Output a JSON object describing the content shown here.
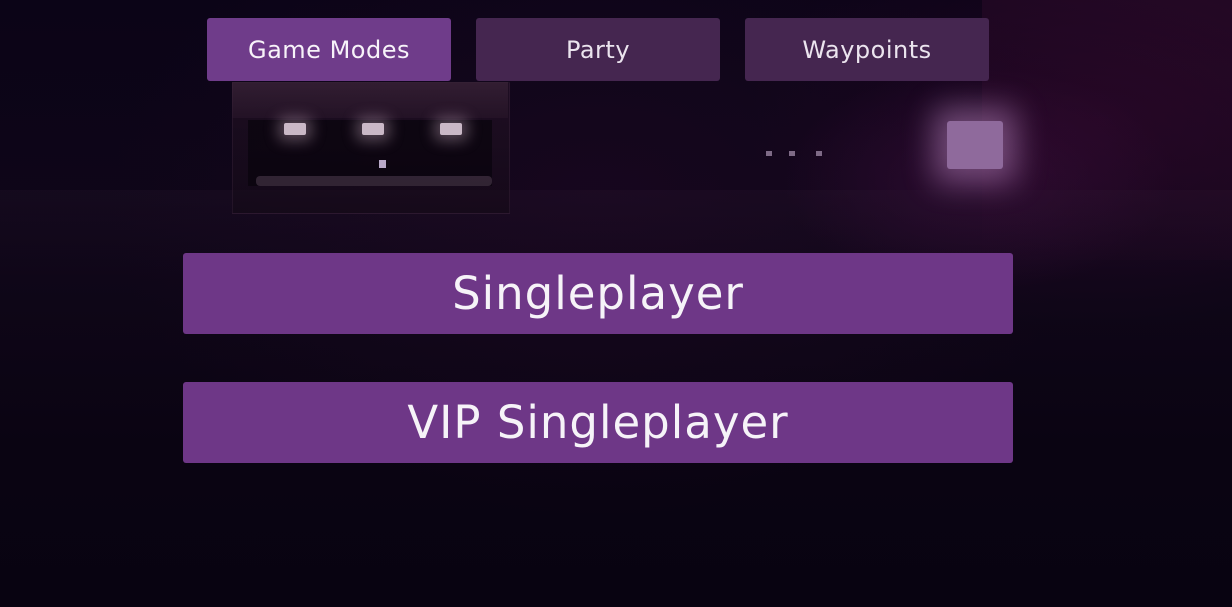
{
  "tabs": [
    {
      "label": "Game Modes",
      "active": true
    },
    {
      "label": "Party",
      "active": false
    },
    {
      "label": "Waypoints",
      "active": false
    }
  ],
  "modes": {
    "singleplayer_label": "Singleplayer",
    "vip_singleplayer_label": "VIP Singleplayer"
  },
  "colors": {
    "active_tab": "#6f3c8a",
    "inactive_tab": "#452650",
    "mode_button": "#6e3787",
    "text": "#f6f3f8",
    "background": "#0b0417"
  }
}
